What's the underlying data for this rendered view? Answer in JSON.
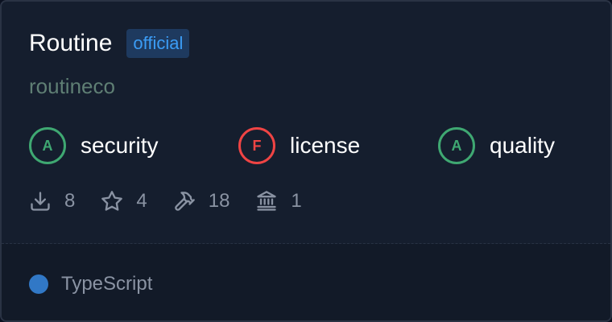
{
  "package": {
    "name": "Routine",
    "badge": "official",
    "owner": "routineco"
  },
  "scores": [
    {
      "grade": "A",
      "label": "security",
      "status": "pass",
      "color": "#3fa872"
    },
    {
      "grade": "F",
      "label": "license",
      "status": "fail",
      "color": "#ef4444"
    },
    {
      "grade": "A",
      "label": "quality",
      "status": "pass",
      "color": "#3fa872"
    }
  ],
  "stats": [
    {
      "icon": "download-icon",
      "value": "8"
    },
    {
      "icon": "star-icon",
      "value": "4"
    },
    {
      "icon": "hammer-icon",
      "value": "18"
    },
    {
      "icon": "bank-icon",
      "value": "1"
    }
  ],
  "language": {
    "name": "TypeScript",
    "color": "#3178c6"
  }
}
